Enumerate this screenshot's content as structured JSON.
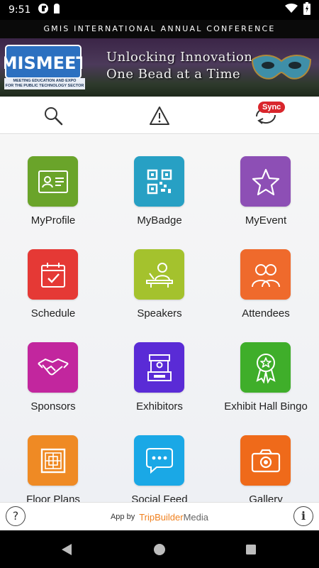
{
  "status_bar": {
    "time": "9:51",
    "icons": [
      "vpn-icon",
      "usb-icon",
      "wifi-icon",
      "battery-charging-icon"
    ]
  },
  "conference_title": "GMIS INTERNATIONAL ANNUAL CONFERENCE",
  "banner": {
    "logo_text": "GMISMEETS",
    "logo_tagline_1": "MEETING EDUCATION AND EXPO",
    "logo_tagline_2": "FOR THE PUBLIC TECHNOLOGY SECTOR",
    "headline_1": "Unlocking Innovation",
    "headline_2": "One Bead at a Time"
  },
  "toolbar": {
    "search_icon": "search-icon",
    "alert_icon": "warning-icon",
    "sync_icon": "sync-icon",
    "sync_label": "Sync"
  },
  "menu": [
    {
      "label": "MyProfile",
      "color": "#6aa42a",
      "icon": "id-card-icon"
    },
    {
      "label": "MyBadge",
      "color": "#27a0c4",
      "icon": "qr-code-icon"
    },
    {
      "label": "MyEvent",
      "color": "#8d4fb5",
      "icon": "star-icon"
    },
    {
      "label": "Schedule",
      "color": "#e53935",
      "icon": "calendar-check-icon"
    },
    {
      "label": "Speakers",
      "color": "#a4c22d",
      "icon": "speaker-podium-icon"
    },
    {
      "label": "Attendees",
      "color": "#ef6a2c",
      "icon": "people-icon"
    },
    {
      "label": "Sponsors",
      "color": "#c2269e",
      "icon": "handshake-icon"
    },
    {
      "label": "Exhibitors",
      "color": "#5a2bd6",
      "icon": "booth-icon"
    },
    {
      "label": "Exhibit Hall Bingo",
      "color": "#3fae2a",
      "icon": "award-ribbon-icon"
    },
    {
      "label": "Floor Plans",
      "color": "#ef8a24",
      "icon": "floor-plan-icon"
    },
    {
      "label": "Social Feed",
      "color": "#1aa8e6",
      "icon": "chat-bubble-icon"
    },
    {
      "label": "Gallery",
      "color": "#ef6a1a",
      "icon": "camera-icon"
    }
  ],
  "footer": {
    "help_glyph": "?",
    "info_glyph": "i",
    "credit_prefix": "App by",
    "credit_brand": "TripBuilder",
    "credit_brand_suffix": "Media"
  },
  "navbar": {
    "back_icon": "back-icon",
    "home_icon": "home-icon",
    "recents_icon": "recents-icon"
  }
}
